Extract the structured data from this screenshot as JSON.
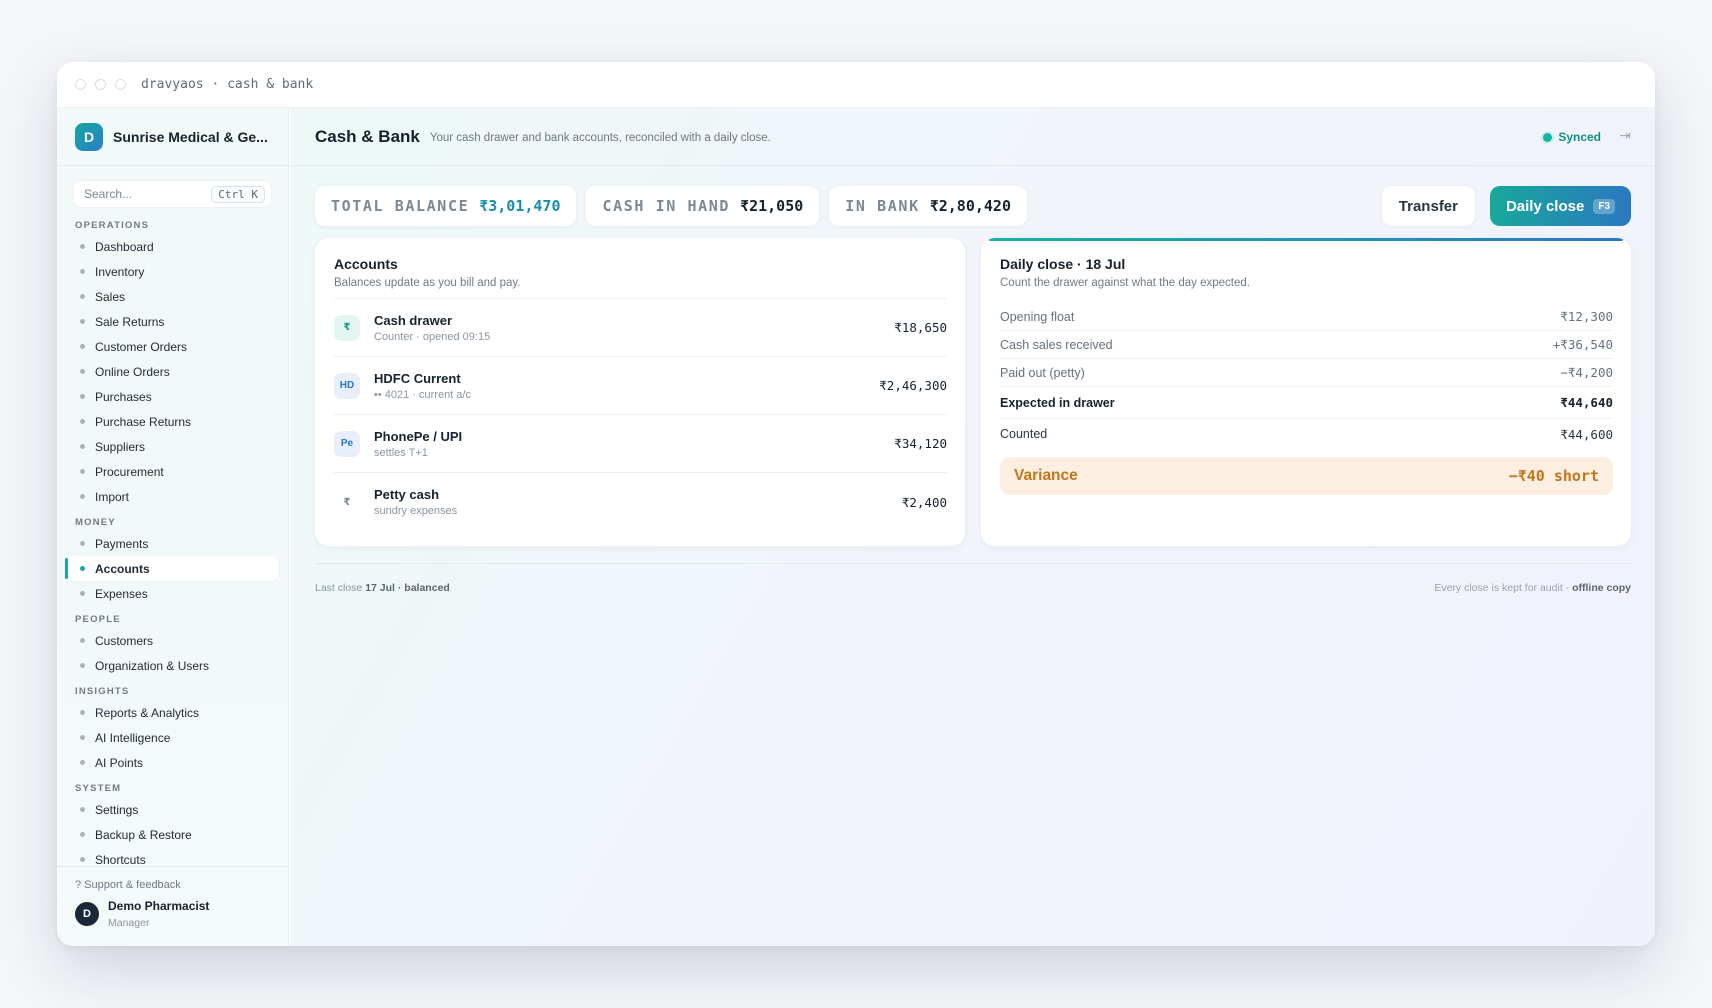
{
  "window": {
    "title": "dravyaos · cash & bank"
  },
  "brand": {
    "initial": "D",
    "name": "Sunrise Medical & Ge..."
  },
  "search": {
    "placeholder": "Search...",
    "shortcut": "Ctrl K"
  },
  "nav": [
    {
      "group": "OPERATIONS",
      "items": [
        "Dashboard",
        "Inventory",
        "Sales",
        "Sale Returns",
        "Customer Orders",
        "Online Orders",
        "Purchases",
        "Purchase Returns",
        "Suppliers",
        "Procurement",
        "Import"
      ]
    },
    {
      "group": "MONEY",
      "items": [
        "Payments",
        "Accounts",
        "Expenses"
      ]
    },
    {
      "group": "PEOPLE",
      "items": [
        "Customers",
        "Organization & Users"
      ]
    },
    {
      "group": "INSIGHTS",
      "items": [
        "Reports & Analytics",
        "AI Intelligence",
        "AI Points"
      ]
    },
    {
      "group": "SYSTEM",
      "items": [
        "Settings",
        "Backup & Restore",
        "Shortcuts"
      ]
    }
  ],
  "active_nav": "Accounts",
  "footer": {
    "support": "? Support & feedback",
    "user_initial": "D",
    "user_name": "Demo Pharmacist",
    "user_role": "Manager"
  },
  "header": {
    "title": "Cash & Bank",
    "subtitle": "Your cash drawer and bank accounts, reconciled with a daily close.",
    "sync_status": "Synced",
    "exit_icon": "⇥"
  },
  "stats": [
    {
      "label": "TOTAL BALANCE",
      "value": "₹3,01,470",
      "accent": "#168fa8"
    },
    {
      "label": "CASH IN HAND",
      "value": "₹21,050"
    },
    {
      "label": "IN BANK",
      "value": "₹2,80,420"
    }
  ],
  "actions": {
    "transfer": "Transfer",
    "daily_close": "Daily close",
    "daily_close_key": "F3"
  },
  "accounts": {
    "title": "Accounts",
    "subtitle": "Balances update as you bill and pay.",
    "rows": [
      {
        "icon": "₹",
        "icon_style": "teal",
        "name": "Cash drawer",
        "meta": "Counter · opened 09:15",
        "amount": "₹18,650"
      },
      {
        "icon": "HD",
        "icon_style": "blue",
        "name": "HDFC Current",
        "meta": "•• 4021 · current a/c",
        "amount": "₹2,46,300"
      },
      {
        "icon": "Pe",
        "icon_style": "blue",
        "name": "PhonePe / UPI",
        "meta": "settles T+1",
        "amount": "₹34,120"
      },
      {
        "icon": "₹",
        "icon_style": "plain",
        "name": "Petty cash",
        "meta": "sundry expenses",
        "amount": "₹2,400"
      }
    ]
  },
  "daily_close": {
    "title": "Daily close · 18 Jul",
    "subtitle": "Count the drawer against what the day expected.",
    "rows": [
      {
        "label": "Opening float",
        "value": "₹12,300",
        "style": ""
      },
      {
        "label": "Cash sales received",
        "value": "+₹36,540",
        "style": ""
      },
      {
        "label": "Paid out (petty)",
        "value": "−₹4,200",
        "style": ""
      },
      {
        "label": "Expected in drawer",
        "value": "₹44,640",
        "style": "bold"
      },
      {
        "label": "Counted",
        "value": "₹44,600",
        "style": "plain"
      }
    ],
    "variance_label": "Variance",
    "variance_value": "−₹40 short"
  },
  "status_footer": {
    "left_prefix": "Last close ",
    "left_bold": "17 Jul · balanced",
    "right_prefix": "Every close is kept for audit · ",
    "right_bold": "offline copy"
  }
}
